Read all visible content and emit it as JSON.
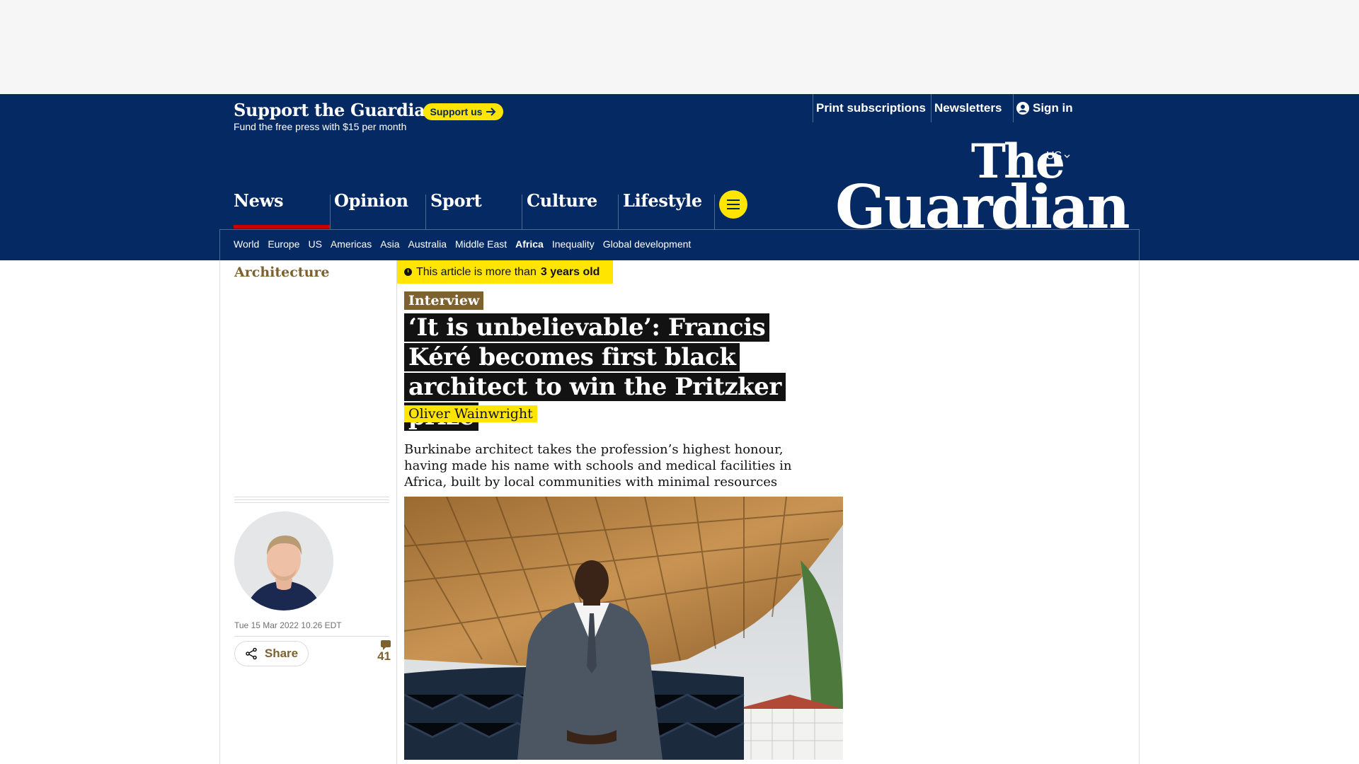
{
  "support": {
    "title": "Support the Guardian",
    "subtitle": "Fund the free press with $15 per month",
    "button": "Support us"
  },
  "top_links": {
    "print": "Print subscriptions",
    "newsletters": "Newsletters",
    "sign_in": "Sign in"
  },
  "edition": "US",
  "logo": {
    "line1": "The",
    "line2": "Guardian"
  },
  "pillars": [
    "News",
    "Opinion",
    "Sport",
    "Culture",
    "Lifestyle"
  ],
  "subnav": [
    "World",
    "Europe",
    "US",
    "Americas",
    "Asia",
    "Australia",
    "Middle East",
    "Africa",
    "Inequality",
    "Global development"
  ],
  "subnav_active": "Africa",
  "article": {
    "section": "Architecture",
    "age_prefix": "This article is more than",
    "age_value": "3 years old",
    "kicker": "Interview",
    "headline": "‘It is unbelievable’: Francis Kéré becomes first black architect to win the Pritzker prize",
    "byline": "Oliver Wainwright",
    "standfirst": "Burkinabe architect takes the profession’s highest honour, having made his name with schools and medical facilities in Africa, built by local communities with minimal resources",
    "date": "Tue 15 Mar 2022 10.26 EDT",
    "share": "Share",
    "comment_count": "41"
  },
  "colors": {
    "brand": "#052962",
    "highlight": "#ffe500",
    "culture": "#7d6230",
    "news_red": "#c70000"
  }
}
